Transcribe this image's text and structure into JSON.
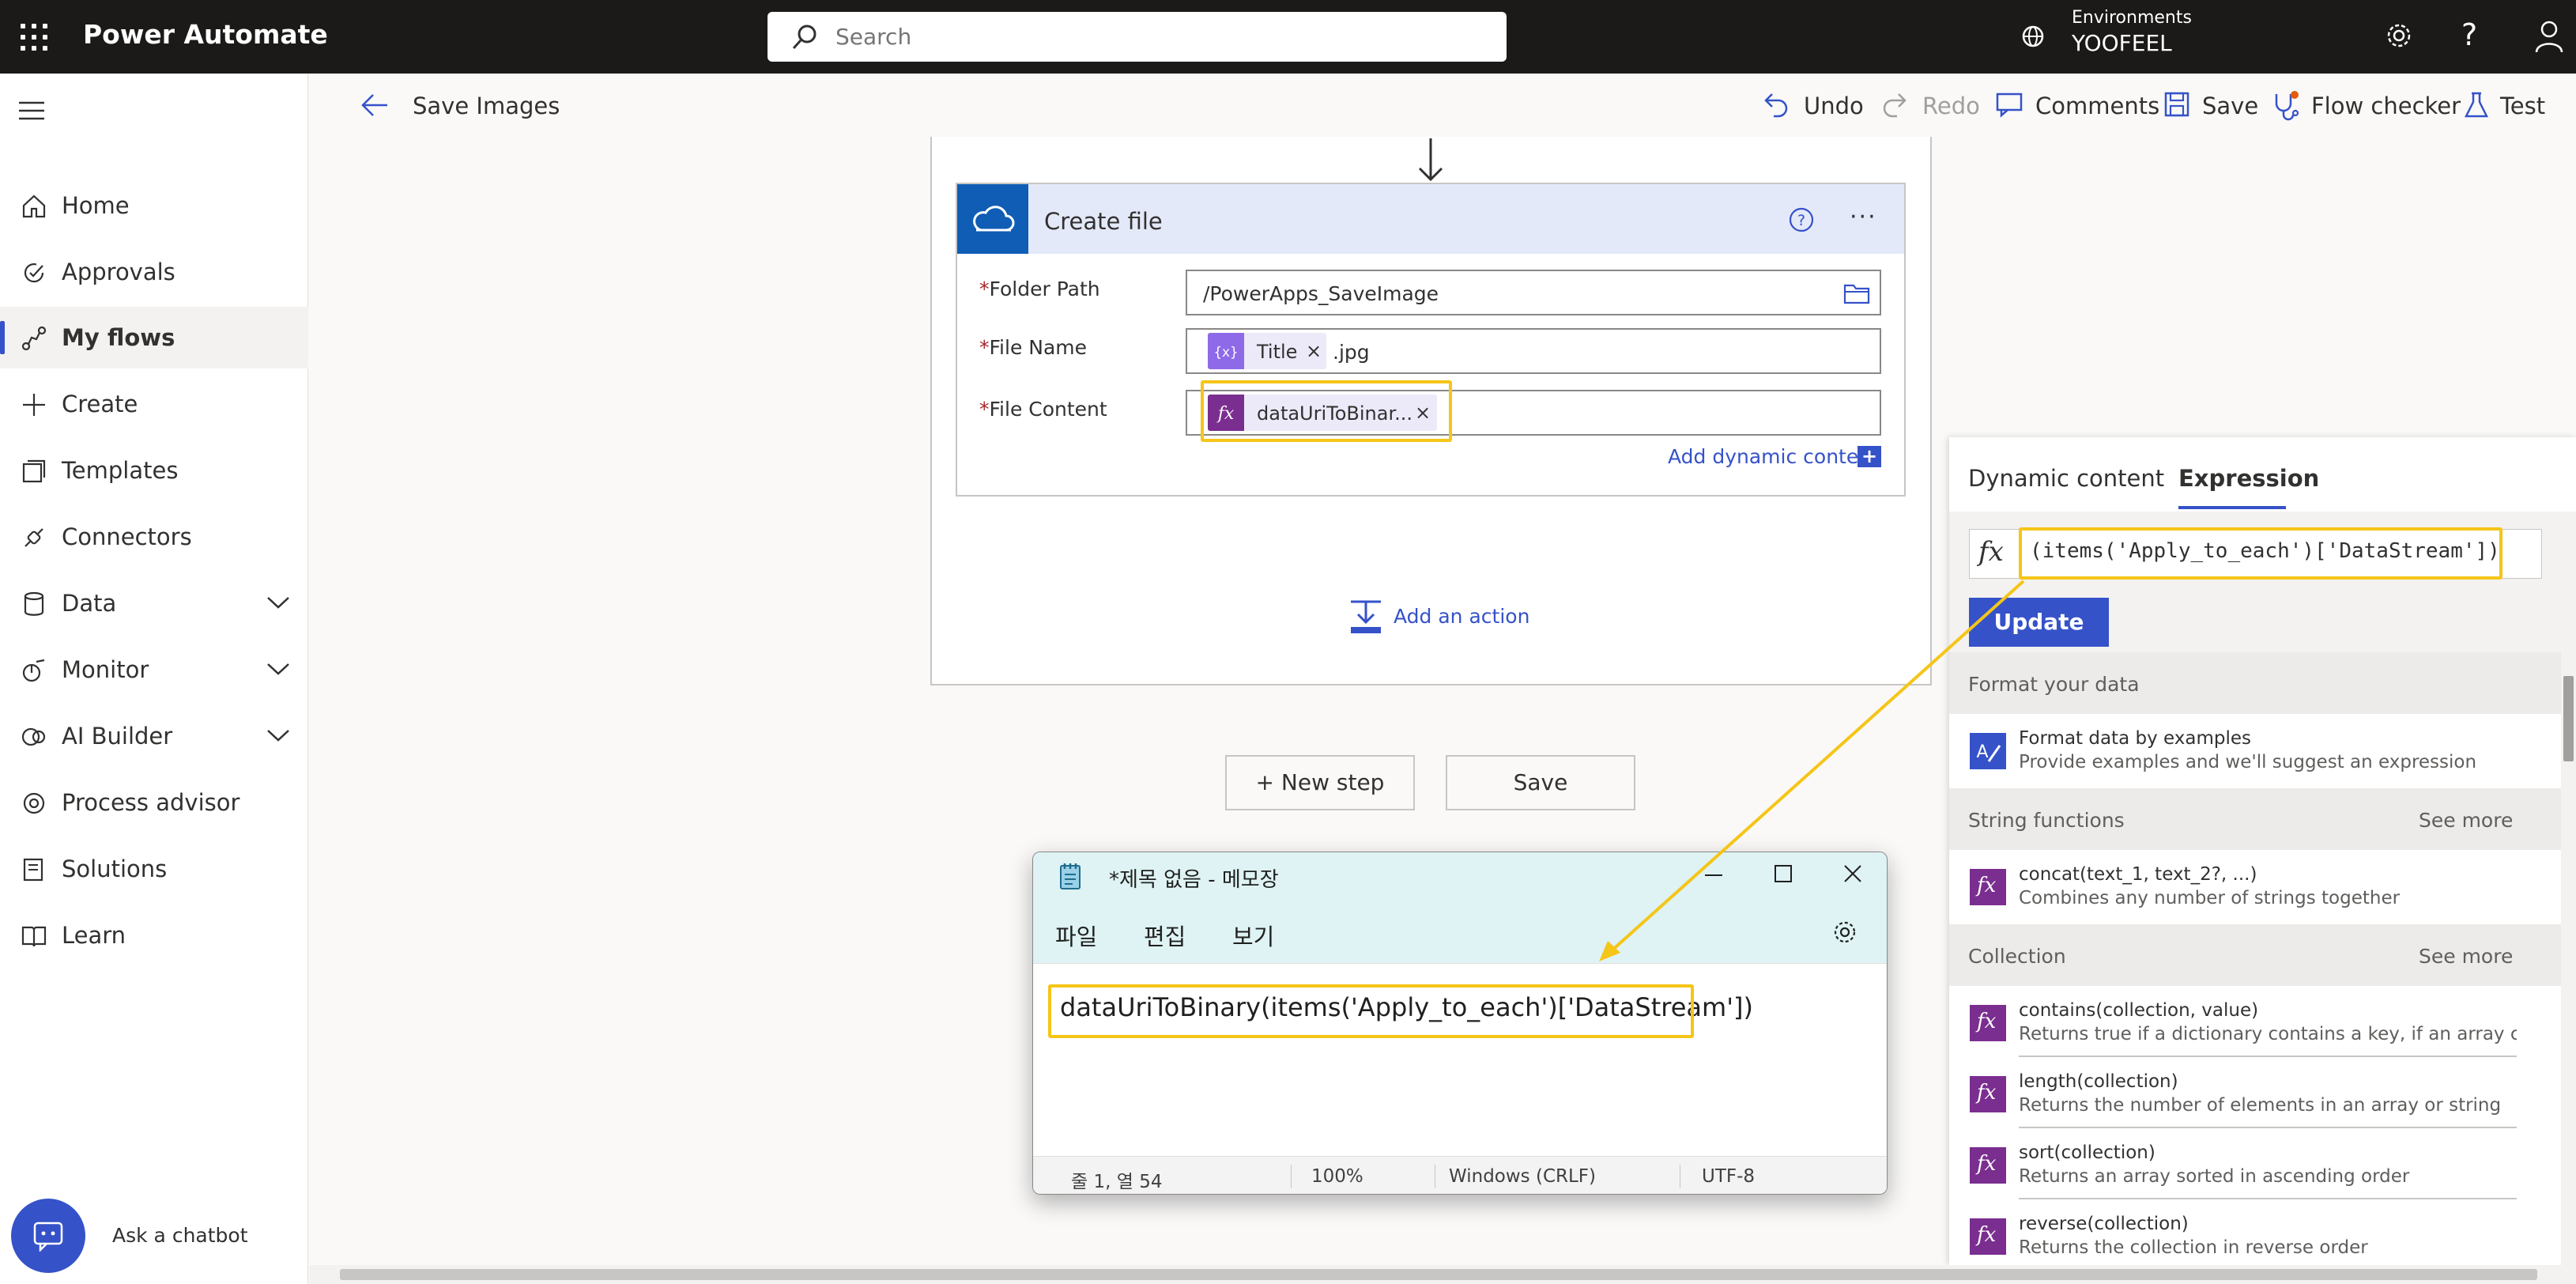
{
  "header": {
    "app_title": "Power Automate",
    "search_placeholder": "Search",
    "environments_label": "Environments",
    "environment_name": "YOOFEEL"
  },
  "nav": {
    "items": [
      {
        "label": "Home",
        "icon": "home-icon"
      },
      {
        "label": "Approvals",
        "icon": "approvals-icon"
      },
      {
        "label": "My flows",
        "icon": "flows-icon",
        "selected": true
      },
      {
        "label": "Create",
        "icon": "plus-icon"
      },
      {
        "label": "Templates",
        "icon": "templates-icon"
      },
      {
        "label": "Connectors",
        "icon": "connectors-icon"
      },
      {
        "label": "Data",
        "icon": "data-icon",
        "expandable": true
      },
      {
        "label": "Monitor",
        "icon": "monitor-icon",
        "expandable": true
      },
      {
        "label": "AI Builder",
        "icon": "ai-builder-icon",
        "expandable": true
      },
      {
        "label": "Process advisor",
        "icon": "process-advisor-icon"
      },
      {
        "label": "Solutions",
        "icon": "solutions-icon"
      },
      {
        "label": "Learn",
        "icon": "learn-icon"
      }
    ],
    "chatbot_label": "Ask a chatbot"
  },
  "commandbar": {
    "flow_name": "Save Images",
    "undo": "Undo",
    "redo": "Redo",
    "comments": "Comments",
    "save": "Save",
    "flow_checker": "Flow checker",
    "test": "Test"
  },
  "card": {
    "title": "Create file",
    "folder_path_label": "Folder Path",
    "folder_path_value": "/PowerApps_SaveImage",
    "file_name_label": "File Name",
    "file_name_token": "Title",
    "file_name_suffix": ".jpg",
    "file_content_label": "File Content",
    "file_content_token": "dataUriToBinar...",
    "add_dynamic_content": "Add dynamic content",
    "token_remove": "×",
    "more": "···"
  },
  "canvas": {
    "add_action": "Add an action",
    "new_step": "+ New step",
    "save": "Save"
  },
  "panel": {
    "tabs": {
      "dynamic": "Dynamic content",
      "expression": "Expression"
    },
    "fx": "fx",
    "expression_value": "(items('Apply_to_each')['DataStream'])",
    "update": "Update",
    "sections": {
      "format": "Format your data",
      "string": "String functions",
      "collection": "Collection",
      "see_more": "See more"
    },
    "format_item": {
      "name": "Format data by examples",
      "desc": "Provide examples and we'll suggest an expression"
    },
    "string_items": [
      {
        "name": "concat(text_1, text_2?, ...)",
        "desc": "Combines any number of strings together"
      }
    ],
    "collection_items": [
      {
        "name": "contains(collection, value)",
        "desc": "Returns true if a dictionary contains a key, if an array cont..."
      },
      {
        "name": "length(collection)",
        "desc": "Returns the number of elements in an array or string"
      },
      {
        "name": "sort(collection)",
        "desc": "Returns an array sorted in ascending order"
      },
      {
        "name": "reverse(collection)",
        "desc": "Returns the collection in reverse order"
      }
    ]
  },
  "notepad": {
    "title": "*제목 없음 - 메모장",
    "menu": {
      "file": "파일",
      "edit": "편집",
      "view": "보기"
    },
    "content": "dataUriToBinary(items('Apply_to_each')['DataStream'])",
    "status": {
      "position": "줄 1, 열 54",
      "zoom": "100%",
      "line_ending": "Windows (CRLF)",
      "encoding": "UTF-8"
    }
  },
  "colors": {
    "accent": "#3552c9",
    "highlight": "#f5c518",
    "onedrive": "#0f5db5",
    "expression_token": "#7a2e8f",
    "variable_token": "#8f6ae8"
  }
}
